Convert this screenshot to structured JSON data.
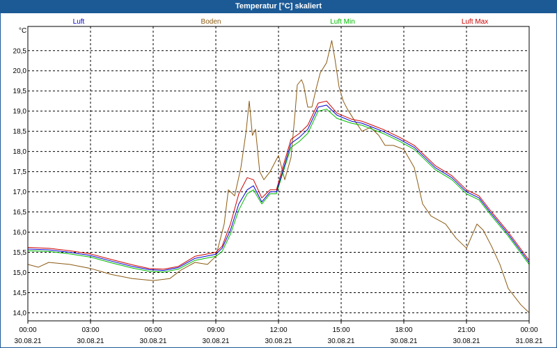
{
  "window": {
    "title": "Temperatur [°C] skaliert"
  },
  "colors": {
    "title_bar": "#1c5a96",
    "grid": "#000000"
  },
  "chart_data": {
    "type": "line",
    "title": "Temperatur [°C] skaliert",
    "ylabel": "°C",
    "xlabel": "",
    "ylim": [
      13.8,
      21.1
    ],
    "xlim": [
      0,
      24
    ],
    "grid": true,
    "legend_position": "top",
    "y_ticks": [
      "14,0",
      "14,5",
      "15,0",
      "15,5",
      "16,0",
      "16,5",
      "17,0",
      "17,5",
      "18,0",
      "18,5",
      "19,0",
      "19,5",
      "20,0",
      "20,5"
    ],
    "y_tick_values": [
      14.0,
      14.5,
      15.0,
      15.5,
      16.0,
      16.5,
      17.0,
      17.5,
      18.0,
      18.5,
      19.0,
      19.5,
      20.0,
      20.5
    ],
    "x_ticks": [
      {
        "time": "00:00",
        "date": "30.08.21"
      },
      {
        "time": "03:00",
        "date": "30.08.21"
      },
      {
        "time": "06:00",
        "date": "30.08.21"
      },
      {
        "time": "09:00",
        "date": "30.08.21"
      },
      {
        "time": "12:00",
        "date": "30.08.21"
      },
      {
        "time": "15:00",
        "date": "30.08.21"
      },
      {
        "time": "18:00",
        "date": "30.08.21"
      },
      {
        "time": "21:00",
        "date": "30.08.21"
      },
      {
        "time": "00:00",
        "date": "31.08.21"
      }
    ],
    "x_tick_values": [
      0,
      3,
      6,
      9,
      12,
      15,
      18,
      21,
      24
    ],
    "series": [
      {
        "name": "Luft",
        "color": "#0000cc",
        "points": [
          [
            0,
            15.58
          ],
          [
            1,
            15.56
          ],
          [
            2,
            15.5
          ],
          [
            3,
            15.42
          ],
          [
            4,
            15.28
          ],
          [
            5,
            15.15
          ],
          [
            5.8,
            15.07
          ],
          [
            6.5,
            15.05
          ],
          [
            7.2,
            15.12
          ],
          [
            8,
            15.35
          ],
          [
            9,
            15.45
          ],
          [
            9.3,
            15.6
          ],
          [
            9.7,
            16.05
          ],
          [
            10.1,
            16.7
          ],
          [
            10.5,
            17.05
          ],
          [
            10.8,
            17.15
          ],
          [
            11.2,
            16.75
          ],
          [
            11.6,
            17.0
          ],
          [
            11.9,
            17.0
          ],
          [
            12.2,
            17.5
          ],
          [
            12.6,
            18.2
          ],
          [
            13.0,
            18.35
          ],
          [
            13.4,
            18.55
          ],
          [
            13.9,
            19.1
          ],
          [
            14.3,
            19.15
          ],
          [
            14.8,
            18.9
          ],
          [
            15.5,
            18.75
          ],
          [
            16.0,
            18.7
          ],
          [
            16.5,
            18.6
          ],
          [
            17.0,
            18.5
          ],
          [
            17.8,
            18.3
          ],
          [
            18.5,
            18.1
          ],
          [
            19.5,
            17.6
          ],
          [
            20.3,
            17.35
          ],
          [
            21.0,
            17.0
          ],
          [
            21.6,
            16.85
          ],
          [
            22.2,
            16.45
          ],
          [
            23.0,
            15.95
          ],
          [
            24,
            15.25
          ]
        ]
      },
      {
        "name": "Boden",
        "color": "#8b5a12",
        "points": [
          [
            0,
            15.2
          ],
          [
            0.5,
            15.13
          ],
          [
            1,
            15.25
          ],
          [
            2,
            15.2
          ],
          [
            3,
            15.1
          ],
          [
            4,
            14.95
          ],
          [
            5,
            14.85
          ],
          [
            6,
            14.8
          ],
          [
            6.8,
            14.85
          ],
          [
            7.3,
            15.05
          ],
          [
            8,
            15.25
          ],
          [
            8.6,
            15.2
          ],
          [
            9,
            15.4
          ],
          [
            9.4,
            16.2
          ],
          [
            9.6,
            17.05
          ],
          [
            9.9,
            16.9
          ],
          [
            10.2,
            17.6
          ],
          [
            10.45,
            18.5
          ],
          [
            10.6,
            19.25
          ],
          [
            10.75,
            18.4
          ],
          [
            10.9,
            18.55
          ],
          [
            11.1,
            17.5
          ],
          [
            11.3,
            17.3
          ],
          [
            11.6,
            17.5
          ],
          [
            12.0,
            17.9
          ],
          [
            12.3,
            17.3
          ],
          [
            12.6,
            17.85
          ],
          [
            12.8,
            19.0
          ],
          [
            12.9,
            19.65
          ],
          [
            13.1,
            19.78
          ],
          [
            13.2,
            19.65
          ],
          [
            13.4,
            19.1
          ],
          [
            13.6,
            19.1
          ],
          [
            13.8,
            19.55
          ],
          [
            14.0,
            19.95
          ],
          [
            14.3,
            20.2
          ],
          [
            14.55,
            20.75
          ],
          [
            14.7,
            20.3
          ],
          [
            14.9,
            19.6
          ],
          [
            15.1,
            19.25
          ],
          [
            15.3,
            19.05
          ],
          [
            15.6,
            18.8
          ],
          [
            16.0,
            18.5
          ],
          [
            16.4,
            18.6
          ],
          [
            16.8,
            18.4
          ],
          [
            17.1,
            18.15
          ],
          [
            17.5,
            18.15
          ],
          [
            18.0,
            18.05
          ],
          [
            18.5,
            17.6
          ],
          [
            18.9,
            16.7
          ],
          [
            19.3,
            16.4
          ],
          [
            20.0,
            16.2
          ],
          [
            20.5,
            15.85
          ],
          [
            21.0,
            15.6
          ],
          [
            21.5,
            16.2
          ],
          [
            21.8,
            16.05
          ],
          [
            22.2,
            15.65
          ],
          [
            22.6,
            15.2
          ],
          [
            23.0,
            14.6
          ],
          [
            23.6,
            14.2
          ],
          [
            24,
            14.0
          ]
        ]
      },
      {
        "name": "Luft Min",
        "color": "#00bb00",
        "points": [
          [
            0,
            15.54
          ],
          [
            1,
            15.52
          ],
          [
            2,
            15.46
          ],
          [
            3,
            15.38
          ],
          [
            4,
            15.24
          ],
          [
            5,
            15.11
          ],
          [
            5.8,
            15.03
          ],
          [
            6.5,
            15.01
          ],
          [
            7.2,
            15.08
          ],
          [
            8,
            15.3
          ],
          [
            9,
            15.4
          ],
          [
            9.3,
            15.52
          ],
          [
            9.7,
            15.95
          ],
          [
            10.1,
            16.55
          ],
          [
            10.5,
            16.95
          ],
          [
            10.8,
            17.05
          ],
          [
            11.2,
            16.7
          ],
          [
            11.6,
            16.95
          ],
          [
            11.9,
            16.95
          ],
          [
            12.2,
            17.45
          ],
          [
            12.6,
            18.1
          ],
          [
            13.0,
            18.25
          ],
          [
            13.4,
            18.45
          ],
          [
            13.9,
            19.0
          ],
          [
            14.3,
            19.05
          ],
          [
            14.8,
            18.82
          ],
          [
            15.5,
            18.7
          ],
          [
            16.0,
            18.65
          ],
          [
            16.5,
            18.55
          ],
          [
            17.0,
            18.45
          ],
          [
            17.8,
            18.25
          ],
          [
            18.5,
            18.05
          ],
          [
            19.5,
            17.55
          ],
          [
            20.3,
            17.3
          ],
          [
            21.0,
            16.95
          ],
          [
            21.6,
            16.8
          ],
          [
            22.2,
            16.4
          ],
          [
            23.0,
            15.9
          ],
          [
            24,
            15.2
          ]
        ]
      },
      {
        "name": "Luft Max",
        "color": "#cc0000",
        "points": [
          [
            0,
            15.62
          ],
          [
            1,
            15.6
          ],
          [
            2,
            15.54
          ],
          [
            3,
            15.46
          ],
          [
            4,
            15.32
          ],
          [
            5,
            15.19
          ],
          [
            5.8,
            15.1
          ],
          [
            6.5,
            15.08
          ],
          [
            7.2,
            15.15
          ],
          [
            8,
            15.4
          ],
          [
            9,
            15.5
          ],
          [
            9.3,
            15.65
          ],
          [
            9.7,
            16.2
          ],
          [
            10.1,
            16.95
          ],
          [
            10.5,
            17.35
          ],
          [
            10.8,
            17.3
          ],
          [
            11.2,
            16.85
          ],
          [
            11.6,
            17.05
          ],
          [
            11.9,
            17.05
          ],
          [
            12.2,
            17.6
          ],
          [
            12.6,
            18.3
          ],
          [
            13.0,
            18.45
          ],
          [
            13.4,
            18.65
          ],
          [
            13.9,
            19.2
          ],
          [
            14.3,
            19.25
          ],
          [
            14.8,
            18.95
          ],
          [
            15.5,
            18.8
          ],
          [
            16.0,
            18.75
          ],
          [
            16.5,
            18.65
          ],
          [
            17.0,
            18.55
          ],
          [
            17.8,
            18.35
          ],
          [
            18.5,
            18.15
          ],
          [
            19.5,
            17.65
          ],
          [
            20.3,
            17.4
          ],
          [
            21.0,
            17.05
          ],
          [
            21.6,
            16.9
          ],
          [
            22.2,
            16.5
          ],
          [
            23.0,
            16.0
          ],
          [
            24,
            15.3
          ]
        ]
      }
    ]
  }
}
